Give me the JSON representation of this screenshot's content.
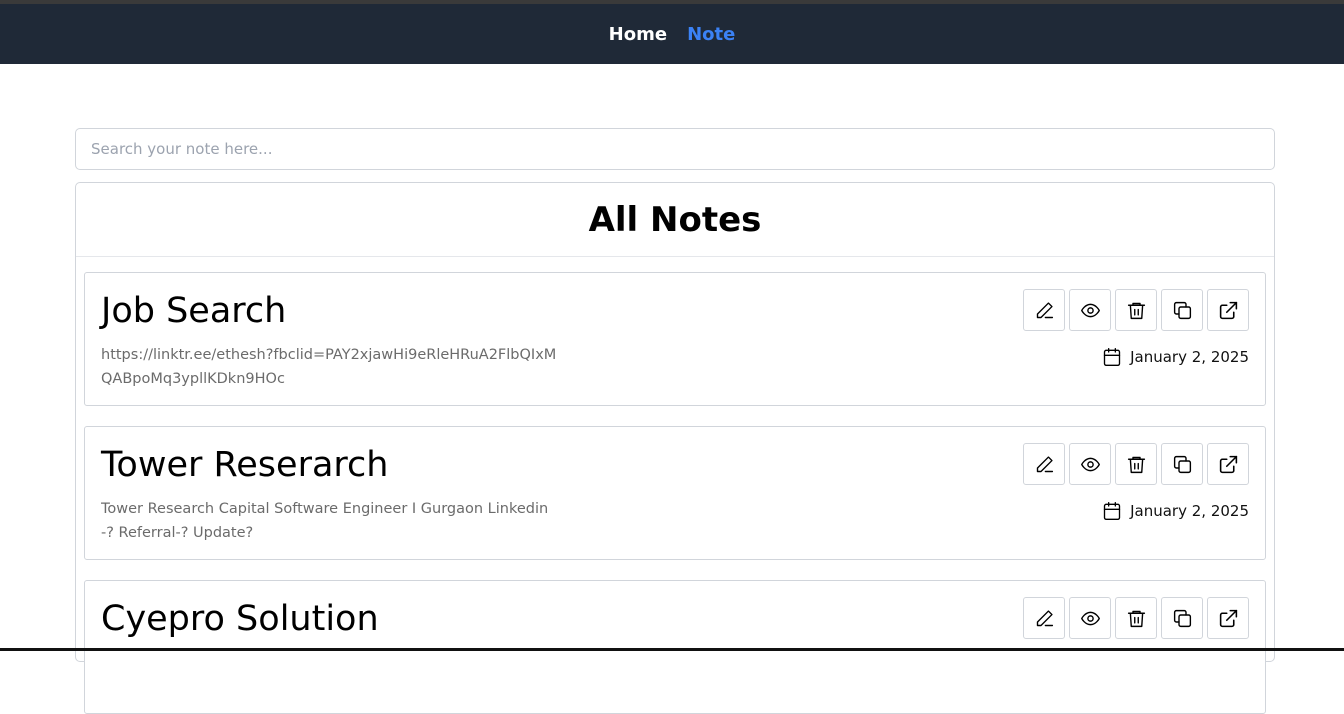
{
  "nav": {
    "home_label": "Home",
    "note_label": "Note",
    "active_color": "#3b82f6",
    "bg_color": "#1f2937"
  },
  "search": {
    "placeholder": "Search your note here...",
    "value": ""
  },
  "panel": {
    "title": "All Notes"
  },
  "notes": [
    {
      "title": "Job Search",
      "content": "https://linktr.ee/ethesh?fbclid=PAY2xjawHi9eRleHRuA2FlbQIxMQABpoMq3ypllKDkn9HOc",
      "date": "January 2, 2025"
    },
    {
      "title": "Tower Reserarch",
      "content": "Tower Research Capital Software Engineer I Gurgaon Linkedin-? Referral-? Update?",
      "date": "January 2, 2025"
    },
    {
      "title": "Cyepro Solution",
      "content": "",
      "date": ""
    }
  ],
  "icons": {
    "edit": "pencil-icon",
    "view": "eye-icon",
    "delete": "trash-icon",
    "copy": "copy-icon",
    "share": "external-link-icon",
    "date": "calendar-icon"
  }
}
